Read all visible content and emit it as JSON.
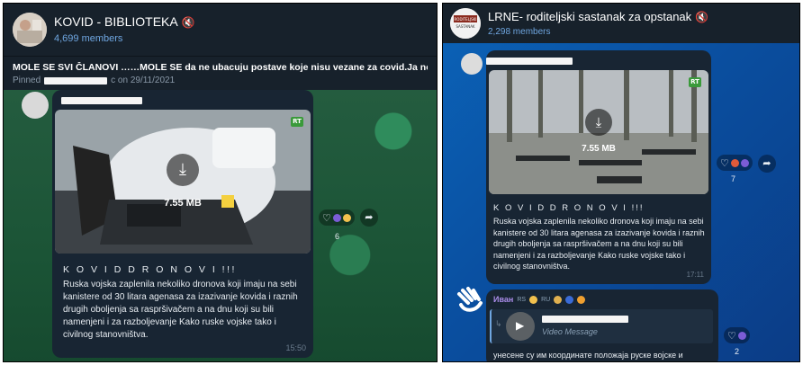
{
  "left_chat": {
    "title": "KOVID - BIBLIOTEKA",
    "members": "4,699 members",
    "pinned_text": "MOLE SE SVI ČLANOVI ……MOLE SE da ne ubacuju postave koje nisu vezane za covid.Ja nemam vre",
    "pinned_prefix": "Pinned",
    "pinned_suffix": "c on 29/11/2021",
    "message": {
      "file_size": "7.55 MB",
      "headline": "K O V I D   D R O N O V I !!!",
      "body": "Ruska vojska zaplenila nekoliko dronova koji imaju na sebi kanistere od 30 litara agenasa za izazivanje kovida i raznih drugih obolјenja sa raspršivačem a na dnu koji su bili namenjeni i za razbolјevanje Kako ruske vojske tako i civilnog stanovništva.",
      "time": "15:50",
      "reaction_count": "6"
    }
  },
  "right_chat": {
    "title": "LRNE- roditeljski sastanak za opstanak",
    "members": "2,298 members",
    "message": {
      "file_size": "7.55 MB",
      "headline": "K O V I D   D R O N O V I !!!",
      "body": "Ruska vojska zaplenila nekoliko dronova koji imaju na sebi kanistere od 30 litara agenasa za izazivanje kovida i raznih drugih obolјenja sa raspršivačem a na dnu koji su bili namenjeni i za razbolјevanje Kako ruske vojske tako i civilnog stanovništva.",
      "time": "17:11",
      "reaction_count": "7"
    },
    "reply": {
      "sender": "Иван",
      "flag_rs": "RS",
      "flag_ru": "RU",
      "quoted_label": "Video Message",
      "text": "унесене су им координате положаја руске војске и",
      "reaction_count": "2"
    }
  },
  "colors": {
    "header_bg": "#17212b",
    "bubble_bg": "#182533",
    "link_blue": "#6fa6e0",
    "sender_purple": "#a98be8"
  }
}
